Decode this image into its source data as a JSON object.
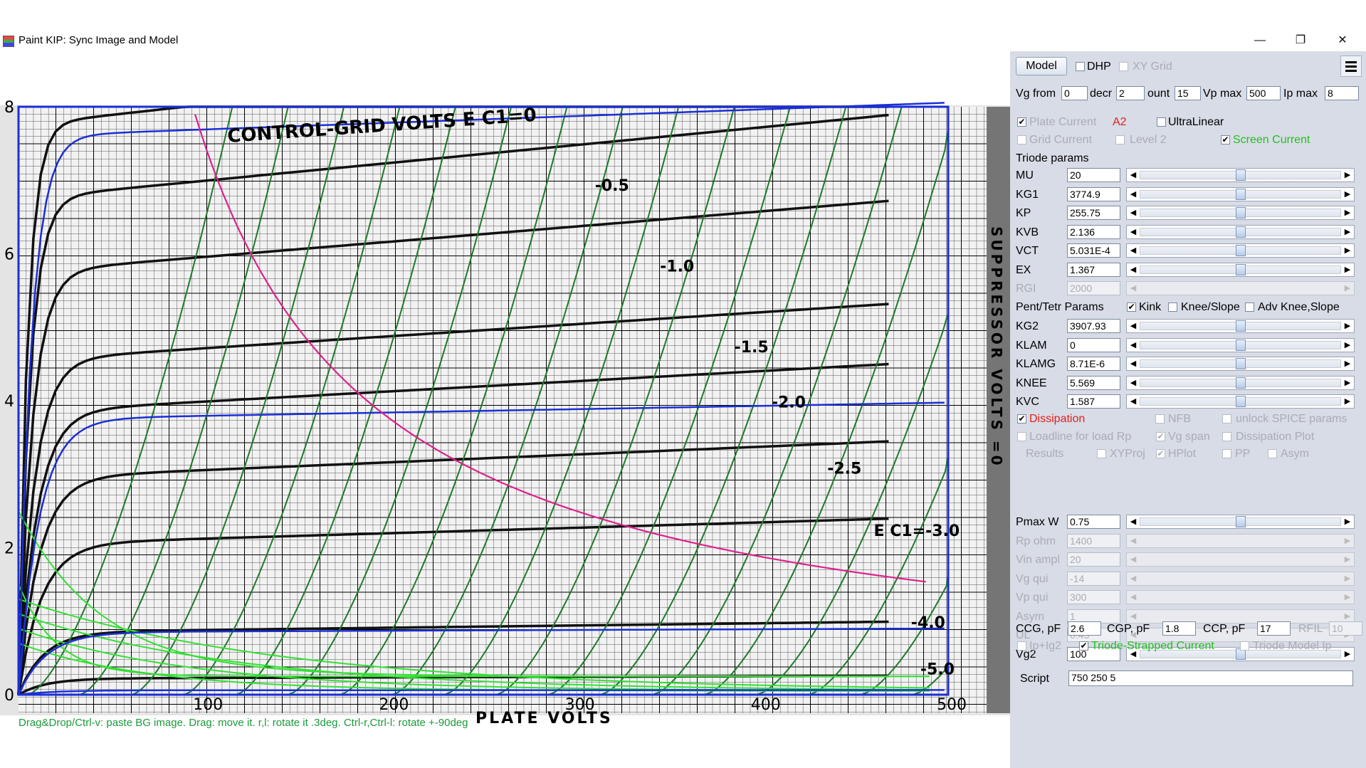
{
  "window": {
    "title": "Paint KIP: Sync Image and Model",
    "minimize": "—",
    "restore": "❐",
    "close": "✕"
  },
  "plot": {
    "x_ticks": [
      "100",
      "200",
      "300",
      "400",
      "500"
    ],
    "y_ticks": [
      "8",
      "6",
      "4",
      "2",
      "0"
    ],
    "bg_title": "CONTROL-GRID VOLTS E C1=0",
    "bg_xlabel": "PLATE VOLTS",
    "bg_side": "SUPPRESSOR VOLTS =0",
    "bg_curves": [
      "-0.5",
      "-1.0",
      "-1.5",
      "-2.0",
      "-2.5",
      "E C1=-3.0",
      "-4.0",
      "-5.0"
    ],
    "hint": "Drag&Drop/Ctrl-v: paste BG image. Drag: move it. r,l: rotate it .3deg. Ctrl-r,Ctrl-l: rotate +-90deg"
  },
  "panel": {
    "model_button": "Model",
    "dhp": "DHP",
    "xygrid": "XY Grid",
    "vg_from": {
      "label": "Vg from",
      "value": "0"
    },
    "decr": {
      "label": "decr",
      "value": "2"
    },
    "count": {
      "label": "ount",
      "value": "15"
    },
    "vpmax": {
      "label": "Vp max",
      "value": "500"
    },
    "ipmax": {
      "label": "Ip max",
      "value": "8"
    },
    "plate_current": "Plate Current",
    "a2": "A2",
    "ultralinear": "UltraLinear",
    "grid_current": "Grid Current",
    "level2": "Level 2",
    "screen_current": "Screen Current",
    "triode_params": "Triode params",
    "params": [
      {
        "name": "MU",
        "value": "20"
      },
      {
        "name": "KG1",
        "value": "3774.9"
      },
      {
        "name": "KP",
        "value": "255.75"
      },
      {
        "name": "KVB",
        "value": "2.136"
      },
      {
        "name": "VCT",
        "value": "5.031E-4"
      },
      {
        "name": "EX",
        "value": "1.367"
      },
      {
        "name": "RGI",
        "value": "2000"
      }
    ],
    "pent_params": "Pent/Tetr Params",
    "kink": "Kink",
    "knee_slope": "Knee/Slope",
    "adv_knee": "Adv Knee,Slope",
    "pent": [
      {
        "name": "KG2",
        "value": "3907.93"
      },
      {
        "name": "KLAM",
        "value": "0"
      },
      {
        "name": "KLAMG",
        "value": "8.71E-6"
      },
      {
        "name": "KNEE",
        "value": "5.569"
      },
      {
        "name": "KVC",
        "value": "1.587"
      }
    ],
    "dissipation": "Dissipation",
    "nfb": "NFB",
    "unlock": "unlock SPICE params",
    "loadline": "Loadline for load Rp",
    "vg_span": "Vg span",
    "diss_plot": "Dissipation Plot",
    "results": "Results",
    "xyproj": "XYProj",
    "hplot": "HPlot",
    "pp": "PP",
    "asym": "Asym",
    "op": [
      {
        "name": "Pmax W",
        "value": "0.75"
      },
      {
        "name": "Rp ohm",
        "value": "1400"
      },
      {
        "name": "Vin ampl",
        "value": "20"
      },
      {
        "name": "Vg qui",
        "value": "-14"
      },
      {
        "name": "Vp qui",
        "value": "300"
      },
      {
        "name": "Asym",
        "value": "1"
      },
      {
        "name": "UL",
        "value": "0.43"
      },
      {
        "name": "Vg2",
        "value": "100"
      }
    ],
    "ccg": {
      "label": "CCG, pF",
      "value": "2.6"
    },
    "cgp": {
      "label": "CGP, pF",
      "value": "1.8"
    },
    "ccp": {
      "label": "CCP, pF",
      "value": "17"
    },
    "rfil": {
      "label": "RFIL",
      "value": "10"
    },
    "ipig2": "Ip+Ig2",
    "triode_strapped": "Triode-Strapped Current",
    "triode_model": "Triode Model Ip",
    "script": {
      "label": "Script",
      "value": "750 250 5"
    }
  }
}
